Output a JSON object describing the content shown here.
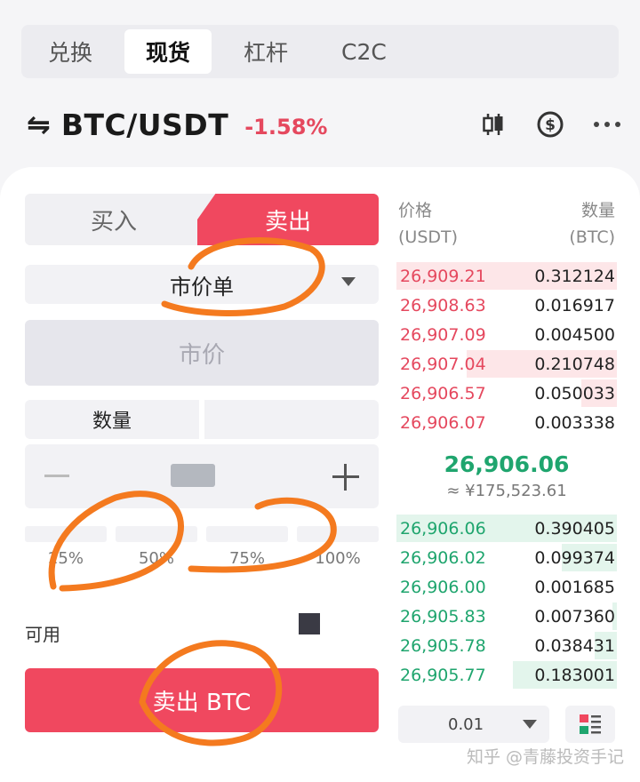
{
  "mode_tabs": [
    {
      "label": "兑换",
      "active": false
    },
    {
      "label": "现货",
      "active": true
    },
    {
      "label": "杠杆",
      "active": false
    },
    {
      "label": "C2C",
      "active": false
    }
  ],
  "pair": {
    "swap_icon": "⇋",
    "name": "BTC/USDT",
    "change": "-1.58%"
  },
  "header_icons": [
    "candlestick-chart-icon",
    "dollar-circle-icon",
    "more-dots-icon"
  ],
  "trade": {
    "buy_label": "买入",
    "sell_label": "卖出",
    "order_type": "市价单",
    "price_placeholder": "市价",
    "qty_label": "数量",
    "percentages": [
      "25%",
      "50%",
      "75%",
      "100%"
    ],
    "available_label": "可用",
    "sell_button": "卖出 BTC"
  },
  "order_book": {
    "price_header": "价格",
    "price_unit": "(USDT)",
    "qty_header": "数量",
    "qty_unit": "(BTC)",
    "asks": [
      {
        "price": "26,909.21",
        "qty": "0.312124",
        "depth": 1.0
      },
      {
        "price": "26,908.63",
        "qty": "0.016917",
        "depth": 0.0
      },
      {
        "price": "26,907.09",
        "qty": "0.004500",
        "depth": 0.0
      },
      {
        "price": "26,907.04",
        "qty": "0.210748",
        "depth": 0.68
      },
      {
        "price": "26,906.57",
        "qty": "0.050033",
        "depth": 0.16
      },
      {
        "price": "26,906.07",
        "qty": "0.003338",
        "depth": 0.0
      }
    ],
    "mid_price": "26,906.06",
    "mid_cny": "≈ ¥175,523.61",
    "bids": [
      {
        "price": "26,906.06",
        "qty": "0.390405",
        "depth": 1.0
      },
      {
        "price": "26,906.02",
        "qty": "0.099374",
        "depth": 0.25
      },
      {
        "price": "26,906.00",
        "qty": "0.001685",
        "depth": 0.0
      },
      {
        "price": "26,905.83",
        "qty": "0.007360",
        "depth": 0.02
      },
      {
        "price": "26,905.78",
        "qty": "0.038431",
        "depth": 0.1
      },
      {
        "price": "26,905.77",
        "qty": "0.183001",
        "depth": 0.47
      }
    ],
    "tick_size": "0.01"
  },
  "colors": {
    "sell": "#f0485f",
    "buy": "#1fa56e",
    "annotation": "#f47a1f"
  },
  "watermark": "知乎 @青藤投资手记"
}
